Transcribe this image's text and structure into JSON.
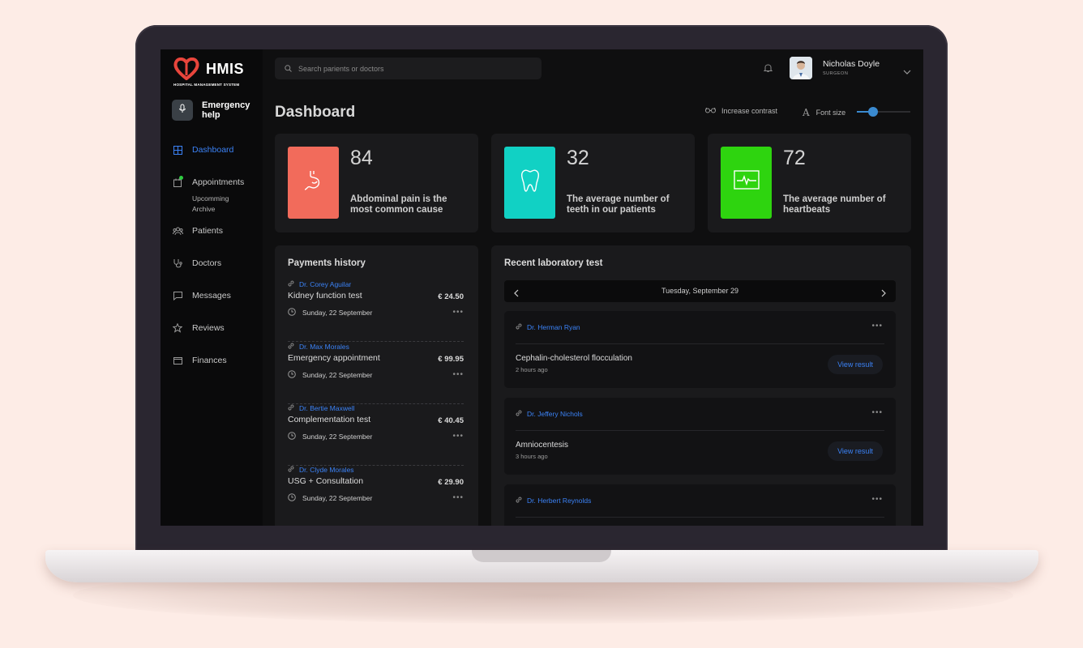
{
  "app": {
    "logo_text": "HMIS",
    "logo_subtitle": "HOSPITAL MANAGEMENT SYSTEM",
    "brand_color": "#e8453c",
    "accent_color": "#3b82f6"
  },
  "sidebar": {
    "emergency_label": "Emergency help",
    "items": [
      {
        "label": "Dashboard",
        "icon": "grid-icon",
        "active": true
      },
      {
        "label": "Appointments",
        "icon": "calendar-icon",
        "badge_color": "#2ecc40"
      },
      {
        "label": "Patients",
        "icon": "users-icon"
      },
      {
        "label": "Doctors",
        "icon": "stethoscope-icon"
      },
      {
        "label": "Messages",
        "icon": "message-icon"
      },
      {
        "label": "Reviews",
        "icon": "star-icon"
      },
      {
        "label": "Finances",
        "icon": "wallet-icon"
      }
    ],
    "appointments_sub": [
      "Upcomming",
      "Archive"
    ]
  },
  "header": {
    "search_placeholder": "Search parients or doctors",
    "user_name": "Nicholas Doyle",
    "user_role": "SURGEON"
  },
  "toolbar": {
    "page_title": "Dashboard",
    "contrast_label": "Increase contrast",
    "font_size_label": "Font size",
    "font_size_level": 0.3
  },
  "stats": [
    {
      "value": "84",
      "text": "Abdominal pain is the most common cause",
      "color": "#f26b5b",
      "icon": "stomach-icon"
    },
    {
      "value": "32",
      "text": "The average number of teeth in our patients",
      "color": "#11d1c4",
      "icon": "tooth-icon"
    },
    {
      "value": "72",
      "text": "The average number of heartbeats",
      "color": "#2ed40f",
      "icon": "heartbeat-icon"
    }
  ],
  "payments": {
    "title": "Payments history",
    "currency": "€",
    "items": [
      {
        "doctor": "Dr. Corey Aguilar",
        "service": "Kidney function test",
        "amount": "€  24.50",
        "date": "Sunday, 22 September"
      },
      {
        "doctor": "Dr. Max Morales",
        "service": "Emergency appointment",
        "amount": "€  99.95",
        "date": "Sunday, 22 September"
      },
      {
        "doctor": "Dr. Bertie Maxwell",
        "service": "Complementation test",
        "amount": "€  40.45",
        "date": "Sunday, 22 September"
      },
      {
        "doctor": "Dr. Clyde Morales",
        "service": "USG + Consultation",
        "amount": "€  29.90",
        "date": "Sunday, 22 September"
      }
    ]
  },
  "lab": {
    "title": "Recent laboratory test",
    "date": "Tuesday, September 29",
    "view_label": "View result",
    "items": [
      {
        "doctor": "Dr. Herman Ryan",
        "test": "Cephalin-cholesterol flocculation",
        "time": "2 hours ago"
      },
      {
        "doctor": "Dr. Jeffery Nichols",
        "test": "Amniocentesis",
        "time": "3 hours ago"
      },
      {
        "doctor": "Dr. Herbert Reynolds",
        "test": "",
        "time": ""
      }
    ]
  }
}
